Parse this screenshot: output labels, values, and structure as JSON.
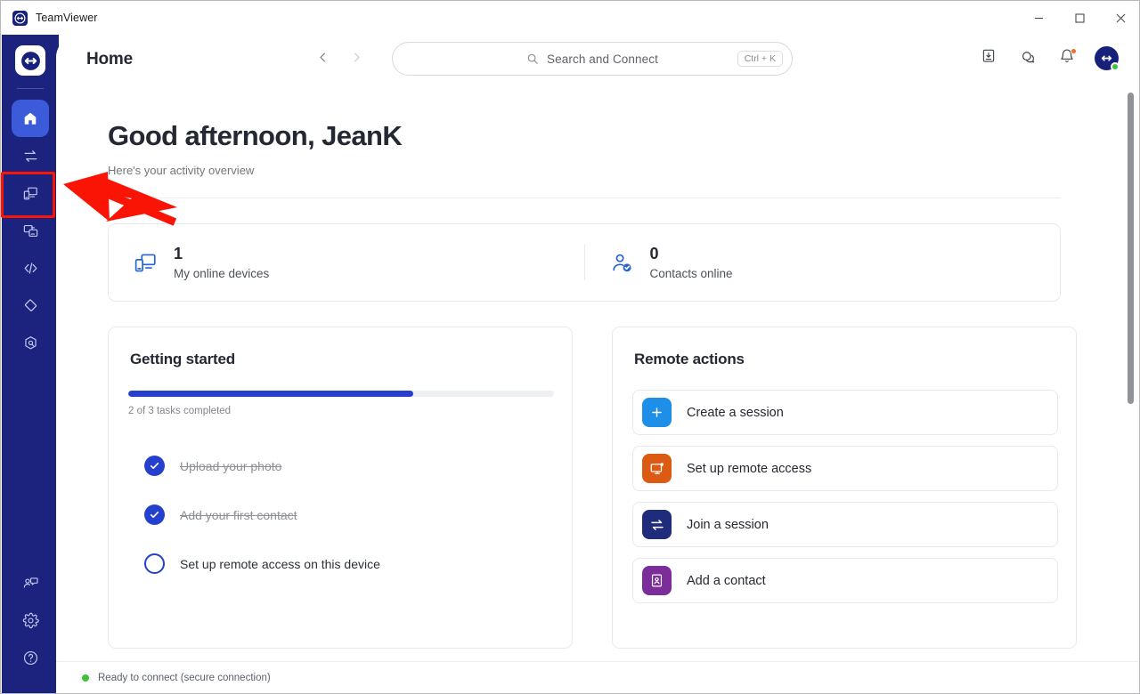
{
  "window": {
    "app_title": "TeamViewer",
    "logo_icon": "teamviewer-logo-icon",
    "minimize_label": "─",
    "maximize_label": "□",
    "close_label": "✕"
  },
  "sidebar": {
    "brand_icon": "teamviewer-logo-icon",
    "items": [
      {
        "name": "home",
        "icon": "home-icon",
        "active": true
      },
      {
        "name": "connections",
        "icon": "transfer-arrows-icon",
        "active": false
      },
      {
        "name": "devices",
        "icon": "devices-icon",
        "active": false,
        "highlighted": true
      },
      {
        "name": "file-transfer",
        "icon": "file-transfer-icon",
        "active": false
      },
      {
        "name": "scripts",
        "icon": "code-brackets-icon",
        "active": false
      },
      {
        "name": "monitoring",
        "icon": "diamond-icon",
        "active": false
      },
      {
        "name": "security",
        "icon": "shield-hex-icon",
        "active": false
      }
    ],
    "bottom_items": [
      {
        "name": "contacts-chat",
        "icon": "contacts-chat-icon"
      },
      {
        "name": "settings",
        "icon": "gear-icon"
      },
      {
        "name": "help",
        "icon": "help-circle-icon"
      }
    ]
  },
  "header": {
    "title": "Home",
    "back_icon": "chevron-left-icon",
    "forward_icon": "chevron-right-icon",
    "search": {
      "icon": "search-icon",
      "placeholder": "Search and Connect",
      "shortcut": "Ctrl + K"
    },
    "icons": [
      {
        "name": "downloads-icon",
        "badge": false
      },
      {
        "name": "chat-bubbles-icon",
        "badge": false
      },
      {
        "name": "bell-icon",
        "badge": true
      }
    ],
    "avatar": {
      "name": "user-avatar",
      "status": "online",
      "status_color": "#3fc238"
    }
  },
  "main": {
    "greeting": "Good afternoon, JeanK",
    "subtitle": "Here's your activity overview",
    "stats": [
      {
        "icon": "devices-icon",
        "value": "1",
        "label": "My online devices"
      },
      {
        "icon": "contact-check-icon",
        "value": "0",
        "label": "Contacts online"
      }
    ],
    "getting_started": {
      "title": "Getting started",
      "progress_percent": 67,
      "progress_label": "2 of 3 tasks completed",
      "tasks": [
        {
          "label": "Upload your photo",
          "completed": true
        },
        {
          "label": "Add your first contact",
          "completed": true
        },
        {
          "label": "Set up remote access on this device",
          "completed": false
        }
      ]
    },
    "remote_actions": {
      "title": "Remote actions",
      "items": [
        {
          "label": "Create a session",
          "icon": "plus-icon",
          "color": "#1e8fe8"
        },
        {
          "label": "Set up remote access",
          "icon": "remote-screen-icon",
          "color": "#dd5a12"
        },
        {
          "label": "Join a session",
          "icon": "transfer-arrows-icon",
          "color": "#1f2b7b"
        },
        {
          "label": "Add a contact",
          "icon": "contact-book-icon",
          "color": "#7b2d99"
        }
      ]
    }
  },
  "statusbar": {
    "text": "Ready to connect (secure connection)",
    "dot_color": "#3fc238"
  },
  "annotation": {
    "highlight_color": "#fa1405",
    "arrow_target": "sidebar-item-devices"
  }
}
